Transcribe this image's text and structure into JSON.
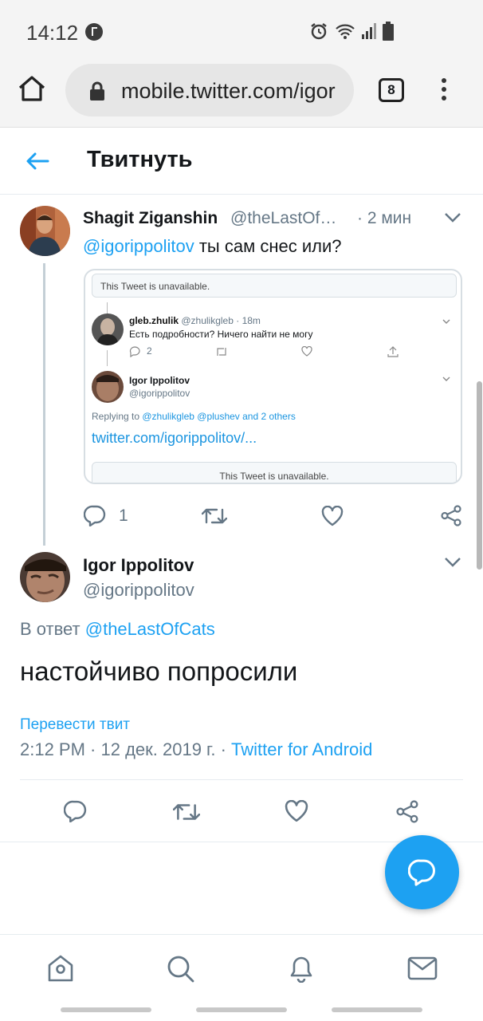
{
  "status_bar": {
    "time": "14:12"
  },
  "browser": {
    "url": "mobile.twitter.com/igor",
    "tab_count": "8"
  },
  "header": {
    "title": "Твитнуть"
  },
  "tweet1": {
    "name": "Shagit Ziganshin",
    "handle": "@theLastOf…",
    "time": "· 2 мин",
    "mention": "@igorippolitov",
    "text": " ты сам снес или?",
    "reply_count": "1"
  },
  "embed": {
    "unavailable_top": "This Tweet is unavailable.",
    "user1_name": "gleb.zhulik",
    "user1_handle": "@zhulikgleb · 18m",
    "user1_text": "Есть подробности? Ничего найти не могу",
    "user1_reply_count": "2",
    "user2_name": "Igor Ippolitov",
    "user2_handle": "@igorippolitov",
    "replying_prefix": "Replying to ",
    "replying_links": "@zhulikgleb @plushev and 2 others",
    "link": "twitter.com/igorippolitov/...",
    "unavailable_bottom": "This Tweet is unavailable."
  },
  "tweet2": {
    "name": "Igor Ippolitov",
    "handle": "@igorippolitov",
    "reply_prefix": "В ответ ",
    "reply_to": "@theLastOfCats",
    "text": "настойчиво попросили",
    "translate": "Перевести твит",
    "meta": "2:12 PM · 12 дек. 2019 г. · ",
    "client": "Twitter for Android"
  },
  "colors": {
    "accent": "#1da1f2",
    "muted": "#657786"
  },
  "icons": [
    "home-icon",
    "lock-icon",
    "back-arrow-icon",
    "chevron-down-icon",
    "reply-icon",
    "retweet-icon",
    "like-icon",
    "share-icon",
    "compose-icon",
    "search-icon",
    "bell-icon",
    "mail-icon"
  ]
}
